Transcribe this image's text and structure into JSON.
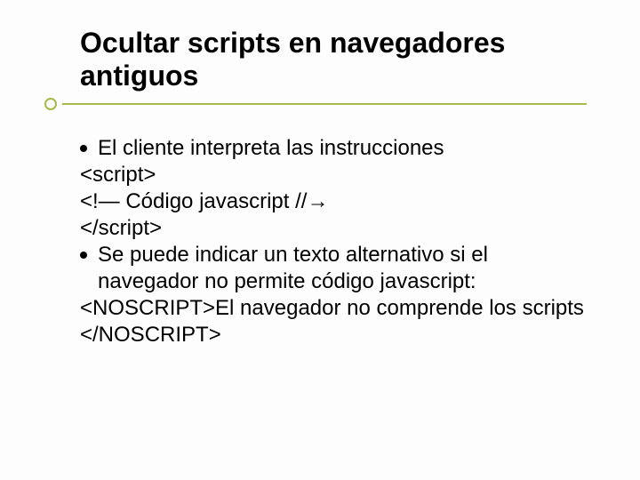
{
  "title": "Ocultar scripts en navegadores antiguos",
  "bullets": [
    {
      "lead": "El cliente interpreta las instrucciones",
      "code": [
        "<script>",
        "<!—   Código javascript //→",
        "</script>"
      ]
    },
    {
      "lead": "Se puede indicar un texto alternativo si el navegador no permite código javascript:",
      "code": [
        "<NOSCRIPT>El navegador no comprende los scripts </NOSCRIPT>"
      ]
    }
  ]
}
